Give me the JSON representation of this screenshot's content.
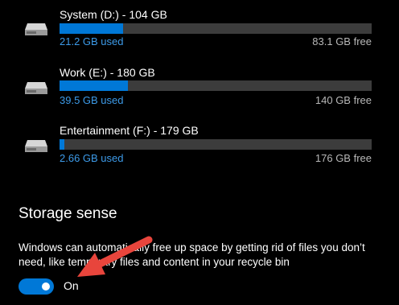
{
  "drives": [
    {
      "name": "System (D:) - 104 GB",
      "used": "21.2 GB used",
      "free": "83.1 GB free",
      "used_fraction": 0.204
    },
    {
      "name": "Work (E:) - 180 GB",
      "used": "39.5 GB used",
      "free": "140 GB free",
      "used_fraction": 0.219
    },
    {
      "name": "Entertainment (F:) - 179 GB",
      "used": "2.66 GB used",
      "free": "176 GB free",
      "used_fraction": 0.015
    }
  ],
  "storage_sense": {
    "title": "Storage sense",
    "description": "Windows can automatically free up space by getting rid of files you don’t need, like temporary files and content in your recycle bin",
    "toggle_state": "On",
    "toggle_on": true
  },
  "icons": {
    "drive": "hard-drive-icon",
    "annotation": "red-arrow-icon"
  },
  "colors": {
    "background": "#000000",
    "accent": "#0078d7",
    "used_text": "#3d9be9",
    "track": "#3c3c3c",
    "annotation": "#e8453c"
  }
}
